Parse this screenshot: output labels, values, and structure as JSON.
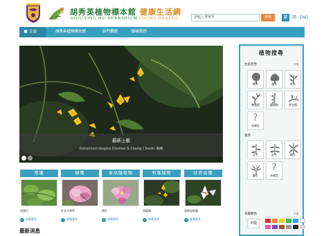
{
  "header": {
    "title_cn_main": "胡秀英植物標本館",
    "title_cn_accent": "健康生活網",
    "title_en_main": "SHIU-YING HU HERBARIUM",
    "title_en_accent": "LIVING HEALTH",
    "search_placeholder": "請輸入搜索字",
    "search_button": "搜尋",
    "lang_tc": "繁",
    "lang_sc": "简",
    "lang_en": "ENG"
  },
  "nav": {
    "items": [
      {
        "label": "主頁"
      },
      {
        "label": "胡秀英植物標本館"
      },
      {
        "label": "新門類館"
      },
      {
        "label": "聯絡我們"
      }
    ]
  },
  "slider": {
    "title": "最新上載",
    "subtitle": "Gelsemium elegans (Gardner & Champ.) Benth. 鉤吻",
    "active_slide": 1,
    "slide_count": 2
  },
  "categories": [
    {
      "tab": "常識",
      "name": "金錢白",
      "more": "查看更多"
    },
    {
      "tab": "樹種",
      "name": "紅花羊蹄甲",
      "more": "查看更多"
    },
    {
      "tab": "食品類植物",
      "name": "桃紅",
      "more": "查看更多"
    },
    {
      "tab": "有毒植物",
      "name": "胡蔓藤",
      "more": "查看更多"
    },
    {
      "tab": "珍奇品種",
      "name": "香港金線蘭",
      "more": "查看更多"
    }
  ],
  "news": {
    "heading": "最新消息"
  },
  "plant_search": {
    "title": "植物搜尋",
    "habit": {
      "label": "生長習性",
      "hint": "可選",
      "options": [
        {
          "label": "喬木",
          "icon": "tree-icon"
        },
        {
          "label": "灌木",
          "icon": "shrub-icon"
        },
        {
          "label": "草本",
          "icon": "herb-icon"
        },
        {
          "label": "攀援植",
          "icon": "climber-icon"
        },
        {
          "label": "纏繞植",
          "icon": "twiner-icon"
        },
        {
          "label": "寄生植",
          "icon": "parasite-icon"
        },
        {
          "label": "未確定",
          "icon": "question-icon"
        }
      ]
    },
    "leaf": {
      "label": "葉序",
      "options": [
        {
          "label": "互生",
          "icon": "alternate-leaf-icon"
        },
        {
          "label": "對生",
          "icon": "opposite-leaf-icon"
        },
        {
          "label": "輪生",
          "icon": "whorled-leaf-icon"
        },
        {
          "label": "叢生",
          "icon": "fascicled-leaf-icon"
        },
        {
          "label": "未確定",
          "icon": "question-icon"
        }
      ]
    },
    "flower_color": {
      "label": "花瓣顏色",
      "hint": "可選",
      "any_label": "不限",
      "swatches": [
        "#d93030",
        "#e8862a",
        "#f2d21e",
        "#3cb44a",
        "#2fa3d8",
        "#ffffff",
        "#e2559a",
        "#8a3fb5",
        "#a0522d",
        "#9a9a9a",
        "#222222",
        "#d8d8d8"
      ]
    }
  }
}
